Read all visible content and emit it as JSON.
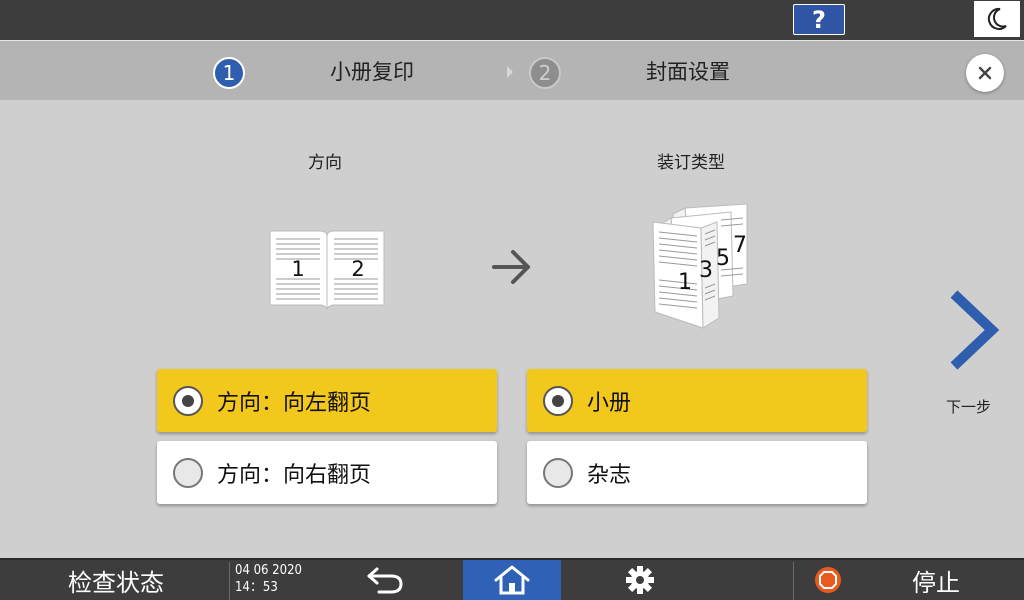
{
  "topbar": {
    "help_label": "?",
    "sleep_icon": "moon-icon"
  },
  "steps": [
    {
      "number": "1",
      "label": "小册复印",
      "state": "active"
    },
    {
      "number": "2",
      "label": "封面设置",
      "state": "inactive"
    }
  ],
  "close_icon": "close-icon",
  "orientation": {
    "heading": "方向",
    "illustration": {
      "left_page": "1",
      "right_page": "2"
    },
    "options": [
      {
        "label": "方向：向左翻页",
        "selected": true
      },
      {
        "label": "方向：向右翻页",
        "selected": false
      }
    ]
  },
  "binding": {
    "heading": "装订类型",
    "illustration": {
      "page_numbers": [
        "1",
        "3",
        "5",
        "7"
      ]
    },
    "options": [
      {
        "label": "小册",
        "selected": true
      },
      {
        "label": "杂志",
        "selected": false
      }
    ]
  },
  "next": {
    "label": "下一步"
  },
  "bottombar": {
    "status_label": "检查状态",
    "date": "04 06 2020",
    "time": "14：53",
    "back_icon": "back-arrow-icon",
    "home_icon": "home-icon",
    "settings_icon": "gear-icon",
    "stop_label": "停止"
  },
  "colors": {
    "accent_blue": "#2f5eae",
    "selected_yellow": "#f2c81d",
    "stop_orange": "#e85a1e"
  }
}
